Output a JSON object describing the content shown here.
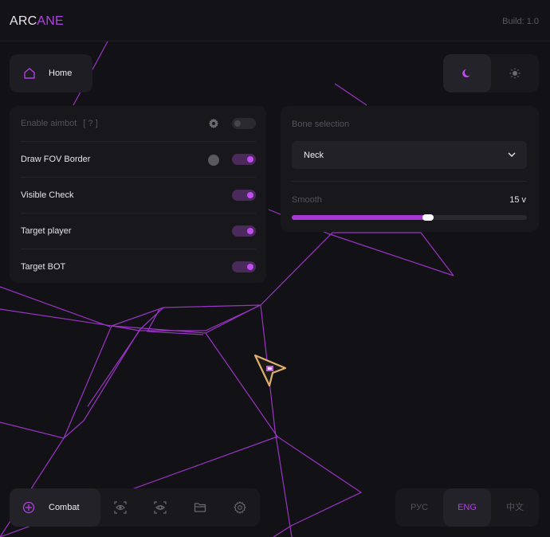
{
  "app": {
    "logo_part1": "ARC",
    "logo_part2": "ANE",
    "build": "Build: 1.0",
    "accent_color": "#b042e0"
  },
  "header": {
    "home_label": "Home",
    "home_icon": "home-icon",
    "theme_options": [
      {
        "name": "dark",
        "icon": "moon-icon",
        "active": true
      },
      {
        "name": "light",
        "icon": "sun-icon",
        "active": false
      }
    ]
  },
  "aimbot": {
    "rows": [
      {
        "label": "Enable aimbot",
        "help": "[ ? ]",
        "enabled": false,
        "disabled": true,
        "extra": "gear-icon"
      },
      {
        "label": "Draw FOV Border",
        "enabled": true,
        "extra": "color-swatch"
      },
      {
        "label": "Visible Check",
        "enabled": true
      },
      {
        "label": "Target player",
        "enabled": true
      },
      {
        "label": "Target BOT",
        "enabled": true
      }
    ]
  },
  "bone": {
    "title": "Bone selection",
    "selected": "Neck",
    "smooth_label": "Smooth",
    "smooth_value": "15 v",
    "smooth_fraction": 0.58
  },
  "bottom_nav": {
    "active_label": "Combat",
    "active_icon": "crosshair-icon",
    "icons": [
      "eye-scan-icon",
      "eye-icon",
      "folder-icon",
      "gear-icon"
    ]
  },
  "languages": {
    "options": [
      "РУС",
      "ENG",
      "中文"
    ],
    "active": "ENG"
  }
}
